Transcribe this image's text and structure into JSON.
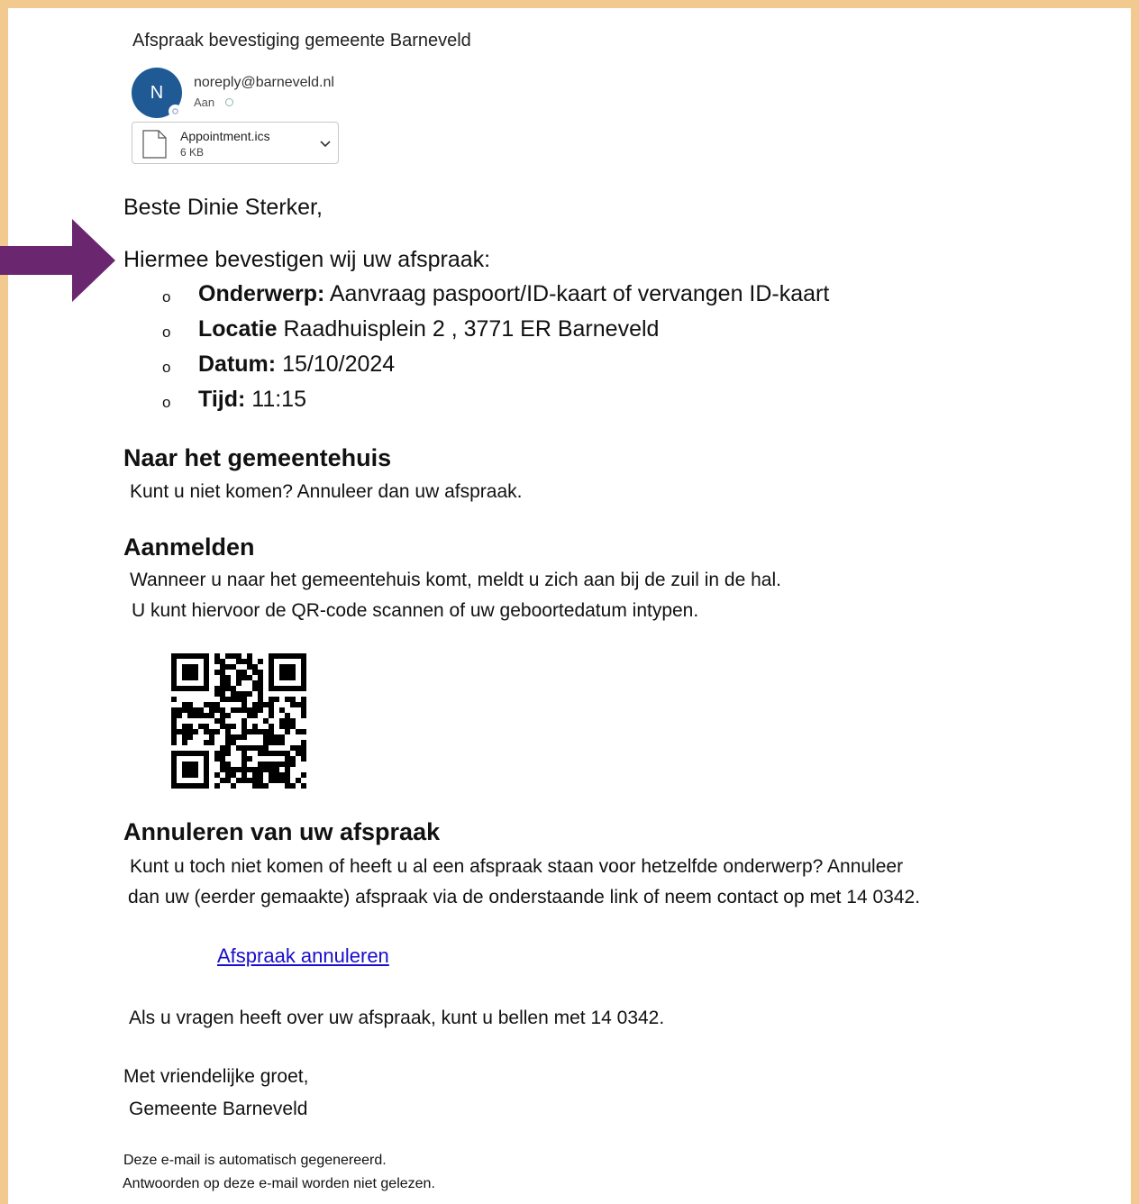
{
  "email": {
    "subject": "Afspraak bevestiging gemeente Barneveld",
    "avatar_initial": "N",
    "sender": "noreply@barneveld.nl",
    "to_label": "Aan",
    "attachment": {
      "name": "Appointment.ics",
      "size": "6 KB",
      "icon": "document-icon"
    }
  },
  "body": {
    "greeting": "Beste Dinie Sterker,",
    "intro": "Hiermee bevestigen wij uw afspraak:",
    "bullet_glyph": "o",
    "details": [
      {
        "label": "Onderwerp:",
        "value": "Aanvraag paspoort/ID-kaart of vervangen ID-kaart"
      },
      {
        "label": "Locatie",
        "value": "Raadhuisplein 2 , 3771 ER Barneveld"
      },
      {
        "label": "Datum:",
        "value": "15/10/2024"
      },
      {
        "label": "Tijd:",
        "value": "11:15"
      }
    ],
    "section_town_hall": {
      "heading": "Naar het gemeentehuis",
      "text": "Kunt u niet komen? Annuleer dan uw afspraak."
    },
    "section_checkin": {
      "heading": "Aanmelden",
      "line1": "Wanneer u naar het gemeentehuis komt, meldt u zich aan bij de zuil in de hal.",
      "line2": "U kunt hiervoor de QR-code scannen of uw geboortedatum intypen."
    },
    "section_cancel": {
      "heading": "Annuleren van uw afspraak",
      "line1": "Kunt u toch niet komen of heeft u al een afspraak staan voor hetzelfde onderwerp? Annuleer",
      "line2": "dan uw (eerder gemaakte) afspraak via de onderstaande link of neem contact op met 14 0342.",
      "link_label": "Afspraak annuleren"
    },
    "questions": "Als u vragen heeft over uw afspraak, kunt u bellen met 14 0342.",
    "closing": "Met vriendelijke groet,",
    "signature": "Gemeente Barneveld",
    "footer_line1": "Deze e-mail is automatisch gegenereerd.",
    "footer_line2": "Antwoorden op deze e-mail worden niet gelezen."
  },
  "colors": {
    "frame": "#f2c98f",
    "avatar": "#1f5a94",
    "arrow": "#6b2670",
    "link": "#1a0dcc"
  }
}
